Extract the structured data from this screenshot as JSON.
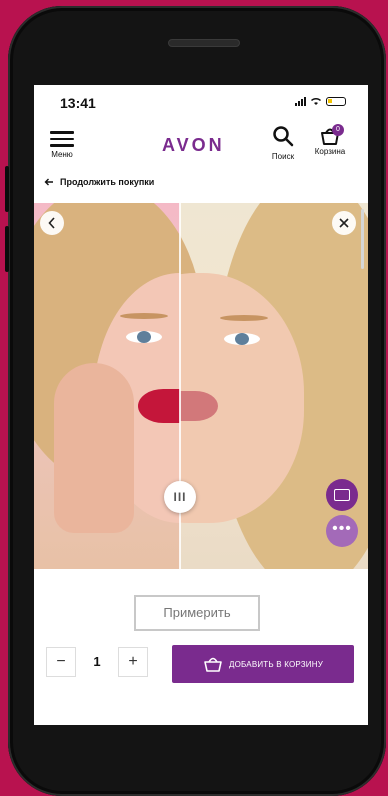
{
  "status_bar": {
    "time": "13:41"
  },
  "header": {
    "menu_label": "Меню",
    "logo": "AVON",
    "search_label": "Поиск",
    "cart_label": "Корзина",
    "cart_count": "0"
  },
  "nav": {
    "back_label": "Продолжить покупки"
  },
  "viewer": {
    "split_handle_glyph": "III"
  },
  "actions": {
    "try_on_label": "Примерить",
    "quantity": "1",
    "minus": "−",
    "plus": "+",
    "add_to_cart_label": "ДОБАВИТЬ В КОРЗИНУ"
  },
  "colors": {
    "brand": "#7a2b8e",
    "background": "#b8124f",
    "lipstick": "#c4163a"
  },
  "icons": [
    "menu-icon",
    "search-icon",
    "cart-icon",
    "back-arrow-icon",
    "chevron-left-icon",
    "close-icon",
    "compare-icon",
    "more-icon",
    "basket-icon"
  ]
}
